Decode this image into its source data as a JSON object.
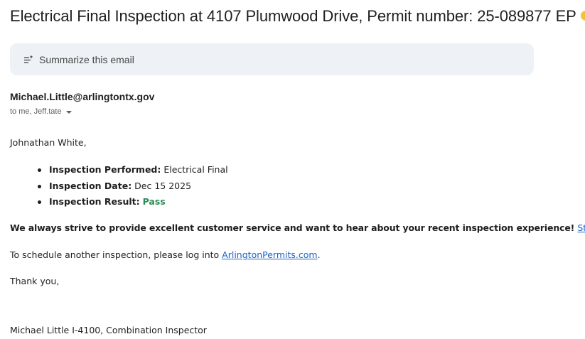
{
  "email": {
    "subject": "Electrical Final Inspection at 4107 Plumwood Drive, Permit number: 25-089877 EP",
    "label_color": "#f2c23a",
    "summarize": {
      "icon": "sparkle-list-icon",
      "label": "Summarize this email"
    },
    "sender": "Michael.Little@arlingtontx.gov",
    "recipients": "to me, Jeff.tate",
    "body": {
      "greeting": "Johnathan White,",
      "details": [
        {
          "key": "Inspection Performed:",
          "value": "Electrical Final"
        },
        {
          "key": "Inspection Date:",
          "value": "Dec 15 2025"
        },
        {
          "key": "Inspection Result:",
          "value": "Pass"
        }
      ],
      "result_color": "#2e8b57",
      "feedback_text": "We always strive to provide excellent customer service and want to hear about your recent inspection experience!",
      "feedback_link": "Start feedback!",
      "schedule_prefix": "To schedule another inspection, please log into",
      "schedule_link": "ArlingtonPermits.com",
      "schedule_suffix": ".",
      "thanks": "Thank you,",
      "signature": "Michael Little I-4100, Combination Inspector"
    }
  }
}
